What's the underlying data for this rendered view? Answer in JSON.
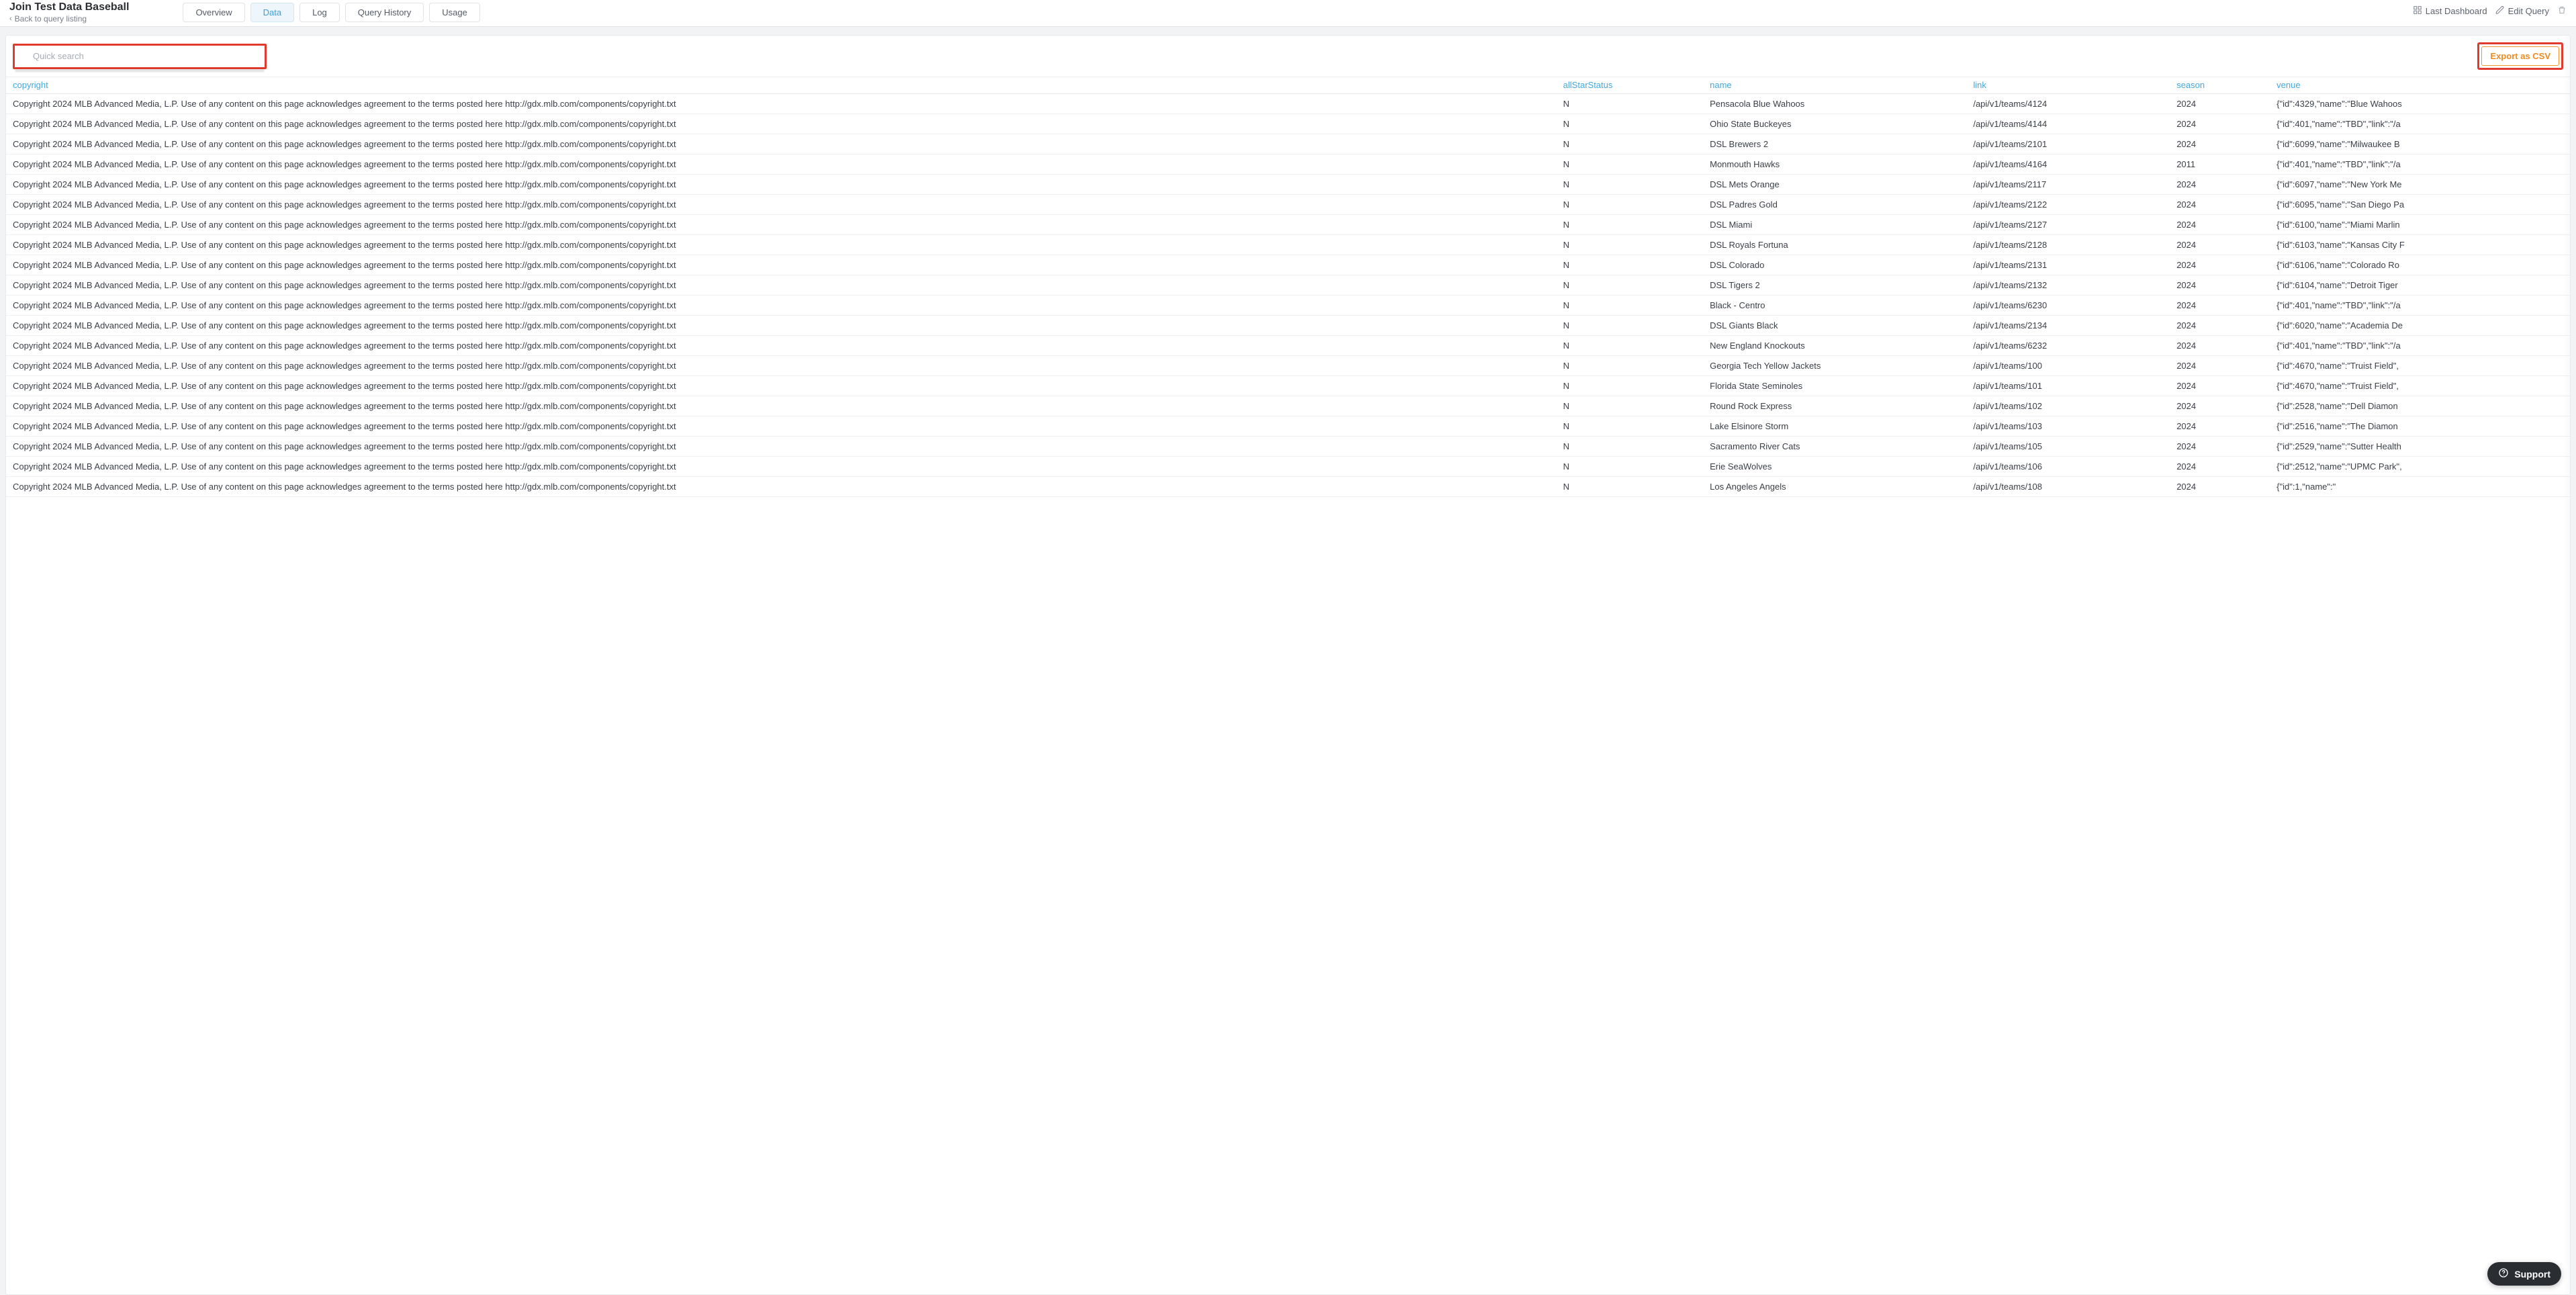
{
  "header": {
    "title": "Join Test Data Baseball",
    "back_label": "Back to query listing",
    "tabs": [
      {
        "label": "Overview",
        "active": false
      },
      {
        "label": "Data",
        "active": true
      },
      {
        "label": "Log",
        "active": false
      },
      {
        "label": "Query History",
        "active": false
      },
      {
        "label": "Usage",
        "active": false
      }
    ],
    "last_dashboard_label": "Last Dashboard",
    "edit_query_label": "Edit Query"
  },
  "toolbar": {
    "search_placeholder": "Quick search",
    "export_label": "Export as CSV"
  },
  "support": {
    "label": "Support"
  },
  "table": {
    "columns": [
      "copyright",
      "allStarStatus",
      "name",
      "link",
      "season",
      "venue"
    ],
    "rows": [
      {
        "copyright": "Copyright 2024 MLB Advanced Media, L.P. Use of any content on this page acknowledges agreement to the terms posted here http://gdx.mlb.com/components/copyright.txt",
        "allStarStatus": "N",
        "name": "Pensacola Blue Wahoos",
        "link": "/api/v1/teams/4124",
        "season": "2024",
        "venue": "{\"id\":4329,\"name\":\"Blue Wahoos"
      },
      {
        "copyright": "Copyright 2024 MLB Advanced Media, L.P. Use of any content on this page acknowledges agreement to the terms posted here http://gdx.mlb.com/components/copyright.txt",
        "allStarStatus": "N",
        "name": "Ohio State Buckeyes",
        "link": "/api/v1/teams/4144",
        "season": "2024",
        "venue": "{\"id\":401,\"name\":\"TBD\",\"link\":\"/a"
      },
      {
        "copyright": "Copyright 2024 MLB Advanced Media, L.P. Use of any content on this page acknowledges agreement to the terms posted here http://gdx.mlb.com/components/copyright.txt",
        "allStarStatus": "N",
        "name": "DSL Brewers 2",
        "link": "/api/v1/teams/2101",
        "season": "2024",
        "venue": "{\"id\":6099,\"name\":\"Milwaukee B"
      },
      {
        "copyright": "Copyright 2024 MLB Advanced Media, L.P. Use of any content on this page acknowledges agreement to the terms posted here http://gdx.mlb.com/components/copyright.txt",
        "allStarStatus": "N",
        "name": "Monmouth Hawks",
        "link": "/api/v1/teams/4164",
        "season": "2011",
        "venue": "{\"id\":401,\"name\":\"TBD\",\"link\":\"/a"
      },
      {
        "copyright": "Copyright 2024 MLB Advanced Media, L.P. Use of any content on this page acknowledges agreement to the terms posted here http://gdx.mlb.com/components/copyright.txt",
        "allStarStatus": "N",
        "name": "DSL Mets Orange",
        "link": "/api/v1/teams/2117",
        "season": "2024",
        "venue": "{\"id\":6097,\"name\":\"New York Me"
      },
      {
        "copyright": "Copyright 2024 MLB Advanced Media, L.P. Use of any content on this page acknowledges agreement to the terms posted here http://gdx.mlb.com/components/copyright.txt",
        "allStarStatus": "N",
        "name": "DSL Padres Gold",
        "link": "/api/v1/teams/2122",
        "season": "2024",
        "venue": "{\"id\":6095,\"name\":\"San Diego Pa"
      },
      {
        "copyright": "Copyright 2024 MLB Advanced Media, L.P. Use of any content on this page acknowledges agreement to the terms posted here http://gdx.mlb.com/components/copyright.txt",
        "allStarStatus": "N",
        "name": "DSL Miami",
        "link": "/api/v1/teams/2127",
        "season": "2024",
        "venue": "{\"id\":6100,\"name\":\"Miami Marlin"
      },
      {
        "copyright": "Copyright 2024 MLB Advanced Media, L.P. Use of any content on this page acknowledges agreement to the terms posted here http://gdx.mlb.com/components/copyright.txt",
        "allStarStatus": "N",
        "name": "DSL Royals Fortuna",
        "link": "/api/v1/teams/2128",
        "season": "2024",
        "venue": "{\"id\":6103,\"name\":\"Kansas City F"
      },
      {
        "copyright": "Copyright 2024 MLB Advanced Media, L.P. Use of any content on this page acknowledges agreement to the terms posted here http://gdx.mlb.com/components/copyright.txt",
        "allStarStatus": "N",
        "name": "DSL Colorado",
        "link": "/api/v1/teams/2131",
        "season": "2024",
        "venue": "{\"id\":6106,\"name\":\"Colorado Ro"
      },
      {
        "copyright": "Copyright 2024 MLB Advanced Media, L.P. Use of any content on this page acknowledges agreement to the terms posted here http://gdx.mlb.com/components/copyright.txt",
        "allStarStatus": "N",
        "name": "DSL Tigers 2",
        "link": "/api/v1/teams/2132",
        "season": "2024",
        "venue": "{\"id\":6104,\"name\":\"Detroit Tiger"
      },
      {
        "copyright": "Copyright 2024 MLB Advanced Media, L.P. Use of any content on this page acknowledges agreement to the terms posted here http://gdx.mlb.com/components/copyright.txt",
        "allStarStatus": "N",
        "name": "Black - Centro",
        "link": "/api/v1/teams/6230",
        "season": "2024",
        "venue": "{\"id\":401,\"name\":\"TBD\",\"link\":\"/a"
      },
      {
        "copyright": "Copyright 2024 MLB Advanced Media, L.P. Use of any content on this page acknowledges agreement to the terms posted here http://gdx.mlb.com/components/copyright.txt",
        "allStarStatus": "N",
        "name": "DSL Giants Black",
        "link": "/api/v1/teams/2134",
        "season": "2024",
        "venue": "{\"id\":6020,\"name\":\"Academia De"
      },
      {
        "copyright": "Copyright 2024 MLB Advanced Media, L.P. Use of any content on this page acknowledges agreement to the terms posted here http://gdx.mlb.com/components/copyright.txt",
        "allStarStatus": "N",
        "name": "New England Knockouts",
        "link": "/api/v1/teams/6232",
        "season": "2024",
        "venue": "{\"id\":401,\"name\":\"TBD\",\"link\":\"/a"
      },
      {
        "copyright": "Copyright 2024 MLB Advanced Media, L.P. Use of any content on this page acknowledges agreement to the terms posted here http://gdx.mlb.com/components/copyright.txt",
        "allStarStatus": "N",
        "name": "Georgia Tech Yellow Jackets",
        "link": "/api/v1/teams/100",
        "season": "2024",
        "venue": "{\"id\":4670,\"name\":\"Truist Field\","
      },
      {
        "copyright": "Copyright 2024 MLB Advanced Media, L.P. Use of any content on this page acknowledges agreement to the terms posted here http://gdx.mlb.com/components/copyright.txt",
        "allStarStatus": "N",
        "name": "Florida State Seminoles",
        "link": "/api/v1/teams/101",
        "season": "2024",
        "venue": "{\"id\":4670,\"name\":\"Truist Field\","
      },
      {
        "copyright": "Copyright 2024 MLB Advanced Media, L.P. Use of any content on this page acknowledges agreement to the terms posted here http://gdx.mlb.com/components/copyright.txt",
        "allStarStatus": "N",
        "name": "Round Rock Express",
        "link": "/api/v1/teams/102",
        "season": "2024",
        "venue": "{\"id\":2528,\"name\":\"Dell Diamon"
      },
      {
        "copyright": "Copyright 2024 MLB Advanced Media, L.P. Use of any content on this page acknowledges agreement to the terms posted here http://gdx.mlb.com/components/copyright.txt",
        "allStarStatus": "N",
        "name": "Lake Elsinore Storm",
        "link": "/api/v1/teams/103",
        "season": "2024",
        "venue": "{\"id\":2516,\"name\":\"The Diamon"
      },
      {
        "copyright": "Copyright 2024 MLB Advanced Media, L.P. Use of any content on this page acknowledges agreement to the terms posted here http://gdx.mlb.com/components/copyright.txt",
        "allStarStatus": "N",
        "name": "Sacramento River Cats",
        "link": "/api/v1/teams/105",
        "season": "2024",
        "venue": "{\"id\":2529,\"name\":\"Sutter Health"
      },
      {
        "copyright": "Copyright 2024 MLB Advanced Media, L.P. Use of any content on this page acknowledges agreement to the terms posted here http://gdx.mlb.com/components/copyright.txt",
        "allStarStatus": "N",
        "name": "Erie SeaWolves",
        "link": "/api/v1/teams/106",
        "season": "2024",
        "venue": "{\"id\":2512,\"name\":\"UPMC Park\","
      },
      {
        "copyright": "Copyright 2024 MLB Advanced Media, L.P. Use of any content on this page acknowledges agreement to the terms posted here http://gdx.mlb.com/components/copyright.txt",
        "allStarStatus": "N",
        "name": "Los Angeles Angels",
        "link": "/api/v1/teams/108",
        "season": "2024",
        "venue": "{\"id\":1,\"name\":\""
      }
    ]
  }
}
